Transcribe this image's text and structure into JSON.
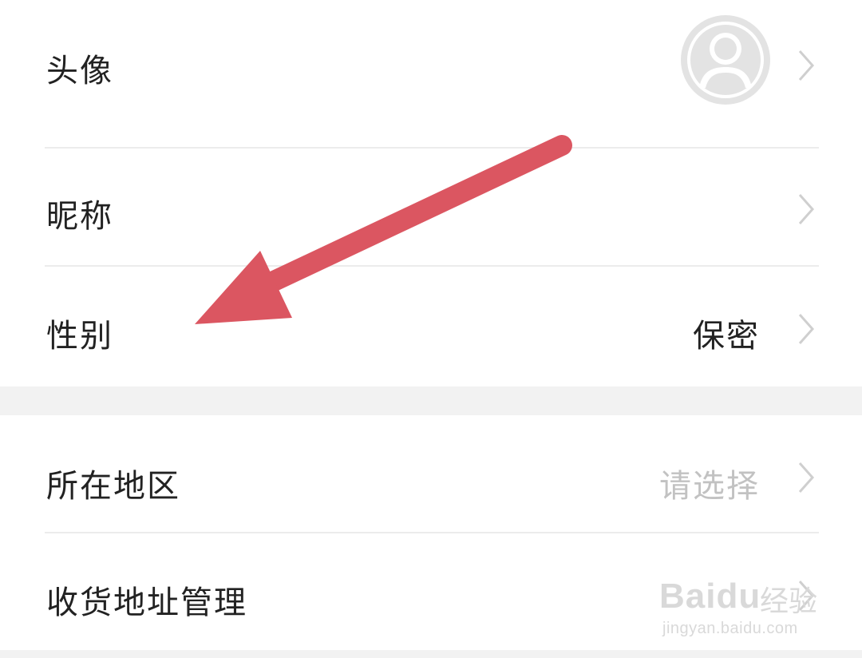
{
  "profile": {
    "avatar_row": {
      "label": "头像"
    },
    "nickname_row": {
      "label": "昵称"
    },
    "gender_row": {
      "label": "性别",
      "value": "保密"
    },
    "region_row": {
      "label": "所在地区",
      "value": "请选择"
    },
    "address_row": {
      "label": "收货地址管理"
    }
  },
  "icons": {
    "chevron": "chevron-right-icon",
    "avatar": "default-avatar-icon"
  },
  "colors": {
    "annotation_arrow": "#db5661",
    "divider": "#ececec",
    "section_gap": "#f2f2f2",
    "placeholder_text": "#c2c2c2"
  },
  "watermark": {
    "brand": "Baidu",
    "suffix": "经验",
    "url": "jingyan.baidu.com"
  }
}
